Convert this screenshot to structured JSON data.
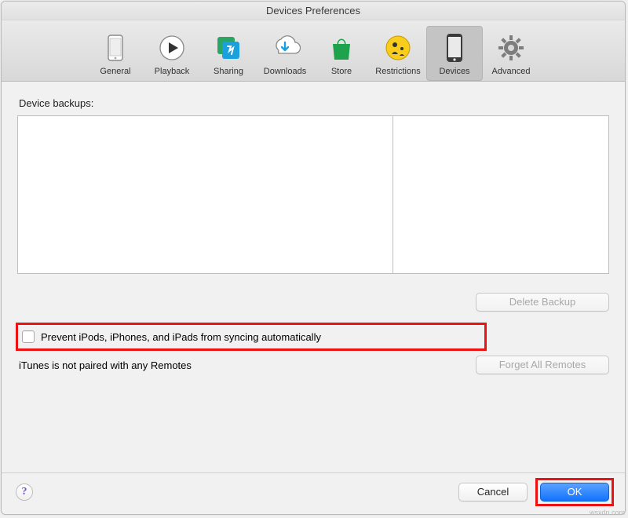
{
  "window": {
    "title": "Devices Preferences"
  },
  "tabs": {
    "general": {
      "label": "General"
    },
    "playback": {
      "label": "Playback"
    },
    "sharing": {
      "label": "Sharing"
    },
    "downloads": {
      "label": "Downloads"
    },
    "store": {
      "label": "Store"
    },
    "restrictions": {
      "label": "Restrictions"
    },
    "devices": {
      "label": "Devices",
      "selected": true
    },
    "advanced": {
      "label": "Advanced"
    }
  },
  "section": {
    "backups_label": "Device backups:"
  },
  "buttons": {
    "delete_backup": "Delete Backup",
    "forget_remotes": "Forget All Remotes",
    "cancel": "Cancel",
    "ok": "OK",
    "help": "?"
  },
  "checkbox": {
    "prevent_sync": "Prevent iPods, iPhones, and iPads from syncing automatically",
    "checked": false
  },
  "status": {
    "remotes": "iTunes is not paired with any Remotes"
  },
  "watermark": "wsxdn.com"
}
